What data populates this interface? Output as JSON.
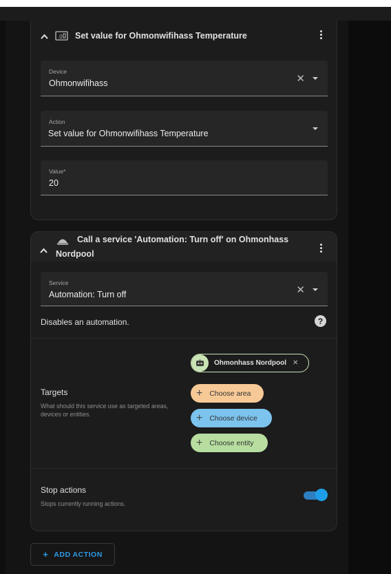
{
  "card1": {
    "title": "Set value for Ohmonwifihass Temperature",
    "icon": "device-number-icon",
    "device": {
      "label": "Device",
      "value": "Ohmonwifihass"
    },
    "action": {
      "label": "Action",
      "value": "Set value for Ohmonwifihass Temperature"
    },
    "value": {
      "label": "Value*",
      "value": "20"
    }
  },
  "card2": {
    "title_line1": "Call a service 'Automation: Turn off' on Ohmonhass",
    "title_line2": "Nordpool",
    "icon": "service-bell-icon",
    "service": {
      "label": "Service",
      "value": "Automation: Turn off"
    },
    "description": "Disables an automation.",
    "targets": {
      "title": "Targets",
      "help": "What should this service use as targeted areas, devices or entities.",
      "selected_chip": "Ohmonhass Nordpool",
      "choose_area": "Choose area",
      "choose_device": "Choose device",
      "choose_entity": "Choose entity"
    },
    "stop_actions": {
      "title": "Stop actions",
      "subtitle": "Stops currently running actions.",
      "enabled": true
    }
  },
  "add_action_label": "ADD ACTION",
  "colors": {
    "accent": "#2e9be6",
    "chip_area": "#f6c996",
    "chip_device": "#7cc3ee",
    "chip_entity": "#b7dea0",
    "chip_selected": "#c9e3b5"
  }
}
